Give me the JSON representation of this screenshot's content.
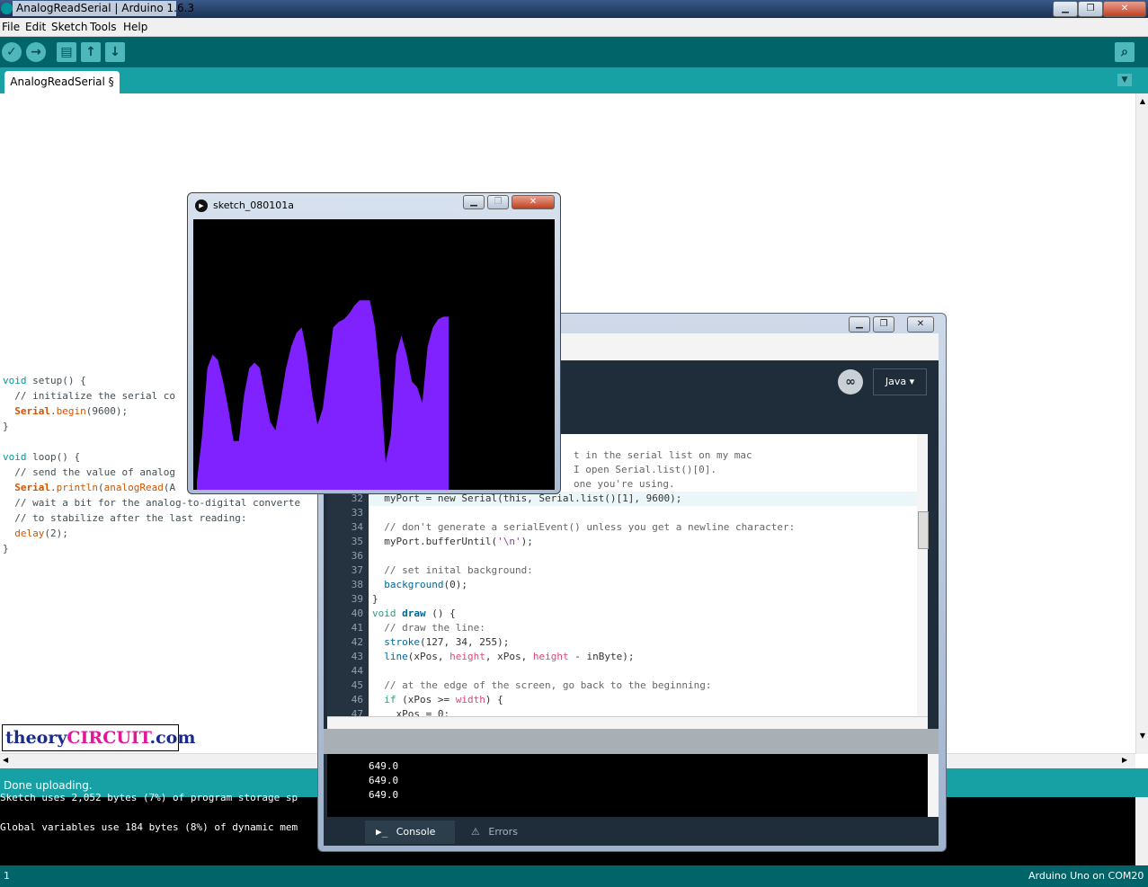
{
  "arduino": {
    "window_title": "AnalogReadSerial | Arduino 1.6.3",
    "menu": [
      "File",
      "Edit",
      "Sketch",
      "Tools",
      "Help"
    ],
    "tab_label": "AnalogReadSerial §",
    "code": {
      "l1a": "void",
      "l1b": " setup() {",
      "l2": "  // initialize the serial co",
      "l3a": "  ",
      "l3b": "Serial",
      "l3c": ".",
      "l3d": "begin",
      "l3e": "(9600);",
      "l4": "}",
      "l6a": "void",
      "l6b": " loop() {",
      "l7": "  // send the value of analog",
      "l8a": "  ",
      "l8b": "Serial",
      "l8c": ".",
      "l8d": "println",
      "l8e": "(",
      "l8f": "analogRead",
      "l8g": "(A",
      "l9": "  // wait a bit for the analog-to-digital converte",
      "l10": "  // to stabilize after the last reading:",
      "l11a": "  ",
      "l11b": "delay",
      "l11c": "(2);",
      "l12": "}"
    },
    "status": "Done uploading.",
    "console_line1": "Sketch uses 2,052 bytes (7%) of program storage sp",
    "console_line2": "Global variables use 184 bytes (8%) of dynamic mem",
    "footer_left": "1",
    "footer_right": "Arduino Uno on COM20",
    "logo_part1": "theory",
    "logo_part2": "CIRCUIT",
    "logo_part3": ".com"
  },
  "processing": {
    "mode_label": "Java ▾",
    "top_lines": [
      "t in the serial list on my mac",
      "I open Serial.list()[0].",
      "one you're using."
    ],
    "line_numbers": [
      "32",
      "33",
      "34",
      "35",
      "36",
      "37",
      "38",
      "39",
      "40",
      "41",
      "42",
      "43",
      "44",
      "45",
      "46",
      "47"
    ],
    "lines": {
      "l32": "  myPort = new Serial(this, Serial.list()[1], 9600);",
      "l34": "  // don't generate a serialEvent() unless you get a newline character:",
      "l35a": "  ",
      "l35b": "myPort.bufferUntil(",
      "l35c": "'\\n'",
      "l35d": ");",
      "l37": "  // set inital background:",
      "l38a": "  ",
      "l38b": "background",
      "l38c": "(0);",
      "l39": "}",
      "l40a": "void",
      "l40b": " ",
      "l40c": "draw",
      "l40d": " () {",
      "l41": "  // draw the line:",
      "l42a": "  ",
      "l42b": "stroke",
      "l42c": "(127, 34, 255);",
      "l43a": "  ",
      "l43b": "line",
      "l43c": "(xPos, ",
      "l43d": "height",
      "l43e": ", xPos, ",
      "l43f": "height",
      "l43g": " - inByte);",
      "l45": "  // at the edge of the screen, go back to the beginning:",
      "l46a": "  ",
      "l46b": "if",
      "l46c": " (xPos >= ",
      "l46d": "width",
      "l46e": ") {",
      "l47": "    xPos = 0;"
    },
    "console_values": [
      "649.0",
      "649.0",
      "649.0",
      "649.0"
    ],
    "tab_console": "Console",
    "tab_errors": "Errors"
  },
  "sketch": {
    "title": "sketch_080101a",
    "graph_color": "#7f22ff",
    "graph_levels": [
      0.03,
      0.2,
      0.45,
      0.5,
      0.48,
      0.4,
      0.3,
      0.18,
      0.18,
      0.35,
      0.45,
      0.47,
      0.45,
      0.35,
      0.25,
      0.22,
      0.33,
      0.45,
      0.53,
      0.58,
      0.6,
      0.5,
      0.35,
      0.24,
      0.3,
      0.45,
      0.6,
      0.62,
      0.63,
      0.65,
      0.68,
      0.7,
      0.7,
      0.7,
      0.6,
      0.4,
      0.1,
      0.2,
      0.5,
      0.57,
      0.5,
      0.4,
      0.38,
      0.32,
      0.53,
      0.6,
      0.63,
      0.64,
      0.64
    ]
  },
  "colors": {
    "arduino_teal_dark": "#006468",
    "arduino_teal": "#17a1a5",
    "arduino_keyword": "#00979c",
    "arduino_function": "#d35400"
  }
}
